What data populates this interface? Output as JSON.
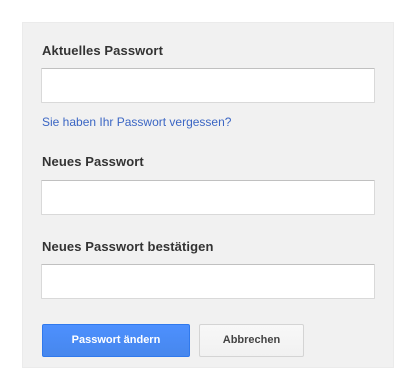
{
  "form": {
    "current_password": {
      "label": "Aktuelles Passwort",
      "value": "",
      "placeholder": ""
    },
    "forgot_link": "Sie haben Ihr Passwort vergessen?",
    "new_password": {
      "label": "Neues Passwort",
      "value": "",
      "placeholder": ""
    },
    "confirm_password": {
      "label": "Neues Passwort bestätigen",
      "value": "",
      "placeholder": ""
    },
    "submit_label": "Passwort ändern",
    "cancel_label": "Abbrechen"
  },
  "colors": {
    "panel_background": "#f1f1f1",
    "link": "#3b66c4",
    "primary_button": "#4d90fe"
  }
}
